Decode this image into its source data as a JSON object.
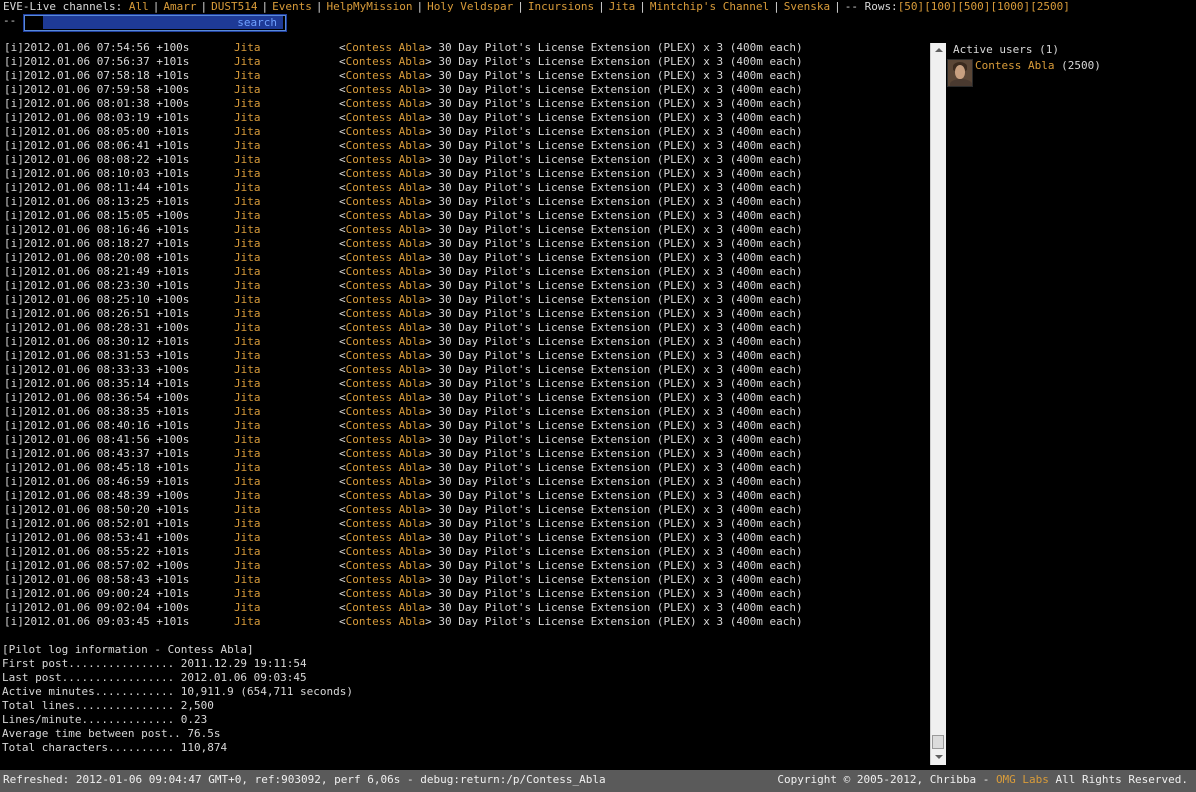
{
  "header": {
    "label": "EVE-Live channels:",
    "channels": [
      "All",
      "Amarr",
      "DUST514",
      "Events",
      "HelpMyMission",
      "Holy Veldspar",
      "Incursions",
      "Jita",
      "Mintchip's Channel",
      "Svenska"
    ],
    "rows_label": "-- Rows:",
    "rows_options": [
      "[50]",
      "[100]",
      "[500]",
      "[1000]",
      "[2500]"
    ],
    "dash": "--",
    "search": {
      "value": "",
      "button_label": "search"
    }
  },
  "log": {
    "channel": "Jita",
    "user": "Contess Abla",
    "message": "30 Day Pilot's License Extension (PLEX) x 3 (400m each)",
    "lines": [
      "[i]2012.01.06 07:54:56 +100s",
      "[i]2012.01.06 07:56:37 +101s",
      "[i]2012.01.06 07:58:18 +101s",
      "[i]2012.01.06 07:59:58 +100s",
      "[i]2012.01.06 08:01:38 +100s",
      "[i]2012.01.06 08:03:19 +101s",
      "[i]2012.01.06 08:05:00 +101s",
      "[i]2012.01.06 08:06:41 +101s",
      "[i]2012.01.06 08:08:22 +101s",
      "[i]2012.01.06 08:10:03 +101s",
      "[i]2012.01.06 08:11:44 +101s",
      "[i]2012.01.06 08:13:25 +101s",
      "[i]2012.01.06 08:15:05 +100s",
      "[i]2012.01.06 08:16:46 +101s",
      "[i]2012.01.06 08:18:27 +101s",
      "[i]2012.01.06 08:20:08 +101s",
      "[i]2012.01.06 08:21:49 +101s",
      "[i]2012.01.06 08:23:30 +101s",
      "[i]2012.01.06 08:25:10 +100s",
      "[i]2012.01.06 08:26:51 +101s",
      "[i]2012.01.06 08:28:31 +100s",
      "[i]2012.01.06 08:30:12 +101s",
      "[i]2012.01.06 08:31:53 +101s",
      "[i]2012.01.06 08:33:33 +100s",
      "[i]2012.01.06 08:35:14 +101s",
      "[i]2012.01.06 08:36:54 +100s",
      "[i]2012.01.06 08:38:35 +101s",
      "[i]2012.01.06 08:40:16 +101s",
      "[i]2012.01.06 08:41:56 +100s",
      "[i]2012.01.06 08:43:37 +101s",
      "[i]2012.01.06 08:45:18 +101s",
      "[i]2012.01.06 08:46:59 +101s",
      "[i]2012.01.06 08:48:39 +100s",
      "[i]2012.01.06 08:50:20 +101s",
      "[i]2012.01.06 08:52:01 +101s",
      "[i]2012.01.06 08:53:41 +100s",
      "[i]2012.01.06 08:55:22 +101s",
      "[i]2012.01.06 08:57:02 +100s",
      "[i]2012.01.06 08:58:43 +101s",
      "[i]2012.01.06 09:00:24 +101s",
      "[i]2012.01.06 09:02:04 +100s",
      "[i]2012.01.06 09:03:45 +101s"
    ]
  },
  "stats": {
    "title": "[Pilot log information - Contess Abla]",
    "rows": [
      "First post................ 2011.12.29 19:11:54",
      "Last post................. 2012.01.06 09:03:45",
      "Active minutes............ 10,911.9 (654,711 seconds)",
      "Total lines............... 2,500",
      "Lines/minute.............. 0.23",
      "Average time between post.. 76.5s",
      "Total characters.......... 110,874"
    ]
  },
  "users": {
    "title": "Active users (1)",
    "list": [
      {
        "name": "Contess Abla",
        "count": "(2500)"
      }
    ]
  },
  "footer": {
    "left": "Refreshed: 2012-01-06 09:04:47 GMT+0, ref:903092, perf 6,06s - debug:return:/p/Contess_Abla",
    "right_prefix": "Copyright © 2005-2012, Chribba - ",
    "right_brand": "OMG Labs",
    "right_suffix": " All Rights Reserved."
  },
  "colors": {
    "accent": "#d99c3a",
    "search_bg": "#1e3a96",
    "footer_bg": "#5a5a5a"
  }
}
